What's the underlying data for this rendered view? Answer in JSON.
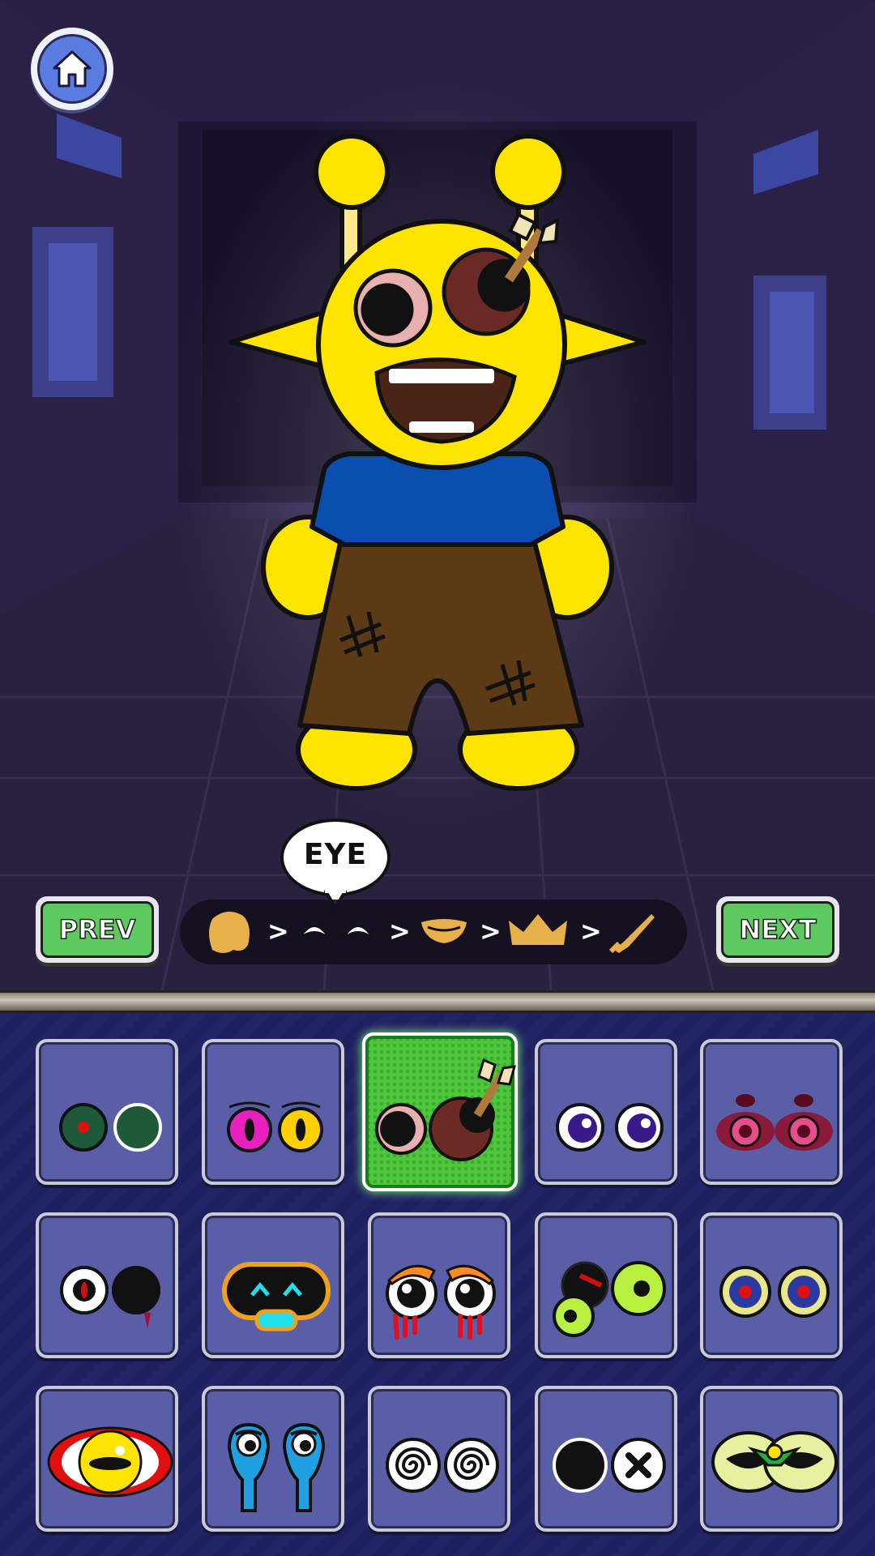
{
  "header": {
    "home_icon": "home-icon"
  },
  "character": {
    "name_hint": ""
  },
  "category_bubble": {
    "label": "EYE"
  },
  "nav": {
    "prev_label": "PREV",
    "next_label": "NEXT"
  },
  "steps": {
    "separator": ">",
    "items": [
      {
        "icon": "head-shape-icon"
      },
      {
        "icon": "eyes-icon"
      },
      {
        "icon": "mouth-icon"
      },
      {
        "icon": "crown-icon"
      },
      {
        "icon": "weapon-icon"
      }
    ],
    "active_index": 1
  },
  "options": {
    "selected_index": 2,
    "items": [
      {
        "icon": "green-red-dot-eyes-icon"
      },
      {
        "icon": "pink-yellow-lashed-eyes-icon"
      },
      {
        "icon": "arrow-pierced-eyes-icon"
      },
      {
        "icon": "purple-sparkle-eyes-icon"
      },
      {
        "icon": "pink-heart-eyes-icon"
      },
      {
        "icon": "red-dot-black-bleeding-eyes-icon"
      },
      {
        "icon": "robot-visor-face-icon"
      },
      {
        "icon": "crying-orange-brow-eyes-icon"
      },
      {
        "icon": "green-monster-eyes-icon"
      },
      {
        "icon": "red-target-eyes-icon"
      },
      {
        "icon": "red-ring-yellow-eye-icon"
      },
      {
        "icon": "blue-drooping-eyes-icon"
      },
      {
        "icon": "spiral-hypno-eyes-icon"
      },
      {
        "icon": "black-and-x-eyes-icon"
      },
      {
        "icon": "green-mask-eyes-icon"
      }
    ]
  },
  "colors": {
    "accent_green": "#5ec95e",
    "panel_bg": "#232466",
    "character_yellow": "#ffe400"
  }
}
